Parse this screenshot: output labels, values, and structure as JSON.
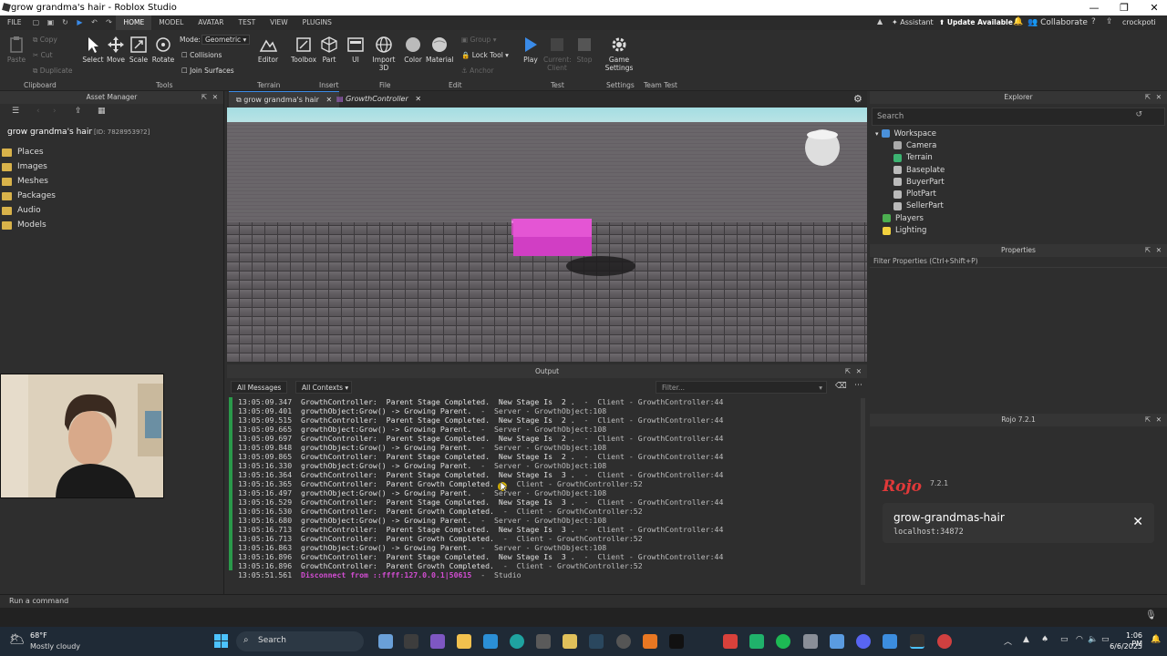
{
  "window": {
    "title": "grow grandma's hair - Roblox Studio"
  },
  "menubar": {
    "file": "FILE",
    "tabs": [
      "HOME",
      "MODEL",
      "AVATAR",
      "TEST",
      "VIEW",
      "PLUGINS"
    ],
    "assistant": "Assistant",
    "update": "Update Available",
    "collaborate": "Collaborate",
    "user": "crockpoti"
  },
  "ribbon": {
    "clipboard": {
      "copy": "Copy",
      "cut": "Cut",
      "paste": "Paste",
      "duplicate": "Duplicate",
      "group": "Clipboard"
    },
    "tools": {
      "select": "Select",
      "move": "Move",
      "scale": "Scale",
      "rotate": "Rotate",
      "group": "Tools",
      "mode_label": "Mode:",
      "mode_value": "Geometric",
      "collisions": "Collisions",
      "join_surfaces": "Join Surfaces"
    },
    "terrain": {
      "editor": "Editor",
      "group": "Terrain"
    },
    "insert": {
      "toolbox": "Toolbox",
      "part": "Part",
      "ui": "UI",
      "group": "Insert"
    },
    "file": {
      "import3d": "Import 3D",
      "group": "File"
    },
    "edit": {
      "color": "Color",
      "material": "Material",
      "group_btn": "Group",
      "lock": "Lock Tool",
      "anchor": "Anchor",
      "group": "Edit"
    },
    "test": {
      "play": "Play",
      "current_client": "Current: Client",
      "stop": "Stop",
      "group": "Test"
    },
    "settings": {
      "game_settings": "Game Settings",
      "group": "Settings"
    },
    "team_test": {
      "group": "Team Test"
    }
  },
  "asset_manager": {
    "title": "Asset Manager",
    "place_name": "grow grandma's hair",
    "place_id": "[ID: 78289539?2]",
    "folders": [
      "Places",
      "Images",
      "Meshes",
      "Packages",
      "Audio",
      "Models"
    ]
  },
  "doc_tabs": [
    {
      "label": "grow grandma's hair"
    },
    {
      "label": "GrowthController"
    }
  ],
  "output": {
    "title": "Output",
    "filter_messages": "All Messages",
    "filter_contexts": "All Contexts",
    "filter_placeholder": "Filter...",
    "lines": [
      {
        "ts": "13:05:09.347",
        "msg": "GrowthController:  Parent Stage Completed.  New Stage Is  2 .",
        "src": "  -  Client - GrowthController:44"
      },
      {
        "ts": "13:05:09.401",
        "msg": "growthObject:Grow() -> Growing Parent.",
        "src": "  -  Server - GrowthObject:108"
      },
      {
        "ts": "13:05:09.515",
        "msg": "GrowthController:  Parent Stage Completed.  New Stage Is  2 .",
        "src": "  -  Client - GrowthController:44"
      },
      {
        "ts": "13:05:09.665",
        "msg": "growthObject:Grow() -> Growing Parent.",
        "src": "  -  Server - GrowthObject:108"
      },
      {
        "ts": "13:05:09.697",
        "msg": "GrowthController:  Parent Stage Completed.  New Stage Is  2 .",
        "src": "  -  Client - GrowthController:44"
      },
      {
        "ts": "13:05:09.848",
        "msg": "growthObject:Grow() -> Growing Parent.",
        "src": "  -  Server - GrowthObject:108"
      },
      {
        "ts": "13:05:09.865",
        "msg": "GrowthController:  Parent Stage Completed.  New Stage Is  2 .",
        "src": "  -  Client - GrowthController:44"
      },
      {
        "ts": "13:05:16.330",
        "msg": "growthObject:Grow() -> Growing Parent.",
        "src": "  -  Server - GrowthObject:108"
      },
      {
        "ts": "13:05:16.364",
        "msg": "GrowthController:  Parent Stage Completed.  New Stage Is  3 .",
        "src": "  -  Client - GrowthController:44"
      },
      {
        "ts": "13:05:16.365",
        "msg": "GrowthController:  Parent Growth Completed.",
        "src": "  -  Client - GrowthController:52"
      },
      {
        "ts": "13:05:16.497",
        "msg": "growthObject:Grow() -> Growing Parent.",
        "src": "  -  Server - GrowthObject:108"
      },
      {
        "ts": "13:05:16.529",
        "msg": "GrowthController:  Parent Stage Completed.  New Stage Is  3 .",
        "src": "  -  Client - GrowthController:44"
      },
      {
        "ts": "13:05:16.530",
        "msg": "GrowthController:  Parent Growth Completed.",
        "src": "  -  Client - GrowthController:52"
      },
      {
        "ts": "13:05:16.680",
        "msg": "growthObject:Grow() -> Growing Parent.",
        "src": "  -  Server - GrowthObject:108"
      },
      {
        "ts": "13:05:16.713",
        "msg": "GrowthController:  Parent Stage Completed.  New Stage Is  3 .",
        "src": "  -  Client - GrowthController:44"
      },
      {
        "ts": "13:05:16.713",
        "msg": "GrowthController:  Parent Growth Completed.",
        "src": "  -  Client - GrowthController:52"
      },
      {
        "ts": "13:05:16.863",
        "msg": "growthObject:Grow() -> Growing Parent.",
        "src": "  -  Server - GrowthObject:108"
      },
      {
        "ts": "13:05:16.896",
        "msg": "GrowthController:  Parent Stage Completed.  New Stage Is  3 .",
        "src": "  -  Client - GrowthController:44"
      },
      {
        "ts": "13:05:16.896",
        "msg": "GrowthController:  Parent Growth Completed.",
        "src": "  -  Client - GrowthController:52"
      },
      {
        "ts": "13:05:51.561",
        "msg": "Disconnect from ::ffff:127.0.0.1|50615",
        "src": "  -  Studio",
        "disconnect": true
      }
    ]
  },
  "explorer": {
    "title": "Explorer",
    "search_placeholder": "Search",
    "items": [
      {
        "label": "Workspace",
        "level": 0
      },
      {
        "label": "Camera",
        "level": 1
      },
      {
        "label": "Terrain",
        "level": 1
      },
      {
        "label": "Baseplate",
        "level": 1
      },
      {
        "label": "BuyerPart",
        "level": 1
      },
      {
        "label": "PlotPart",
        "level": 1
      },
      {
        "label": "SellerPart",
        "level": 1
      },
      {
        "label": "Players",
        "level": 0
      },
      {
        "label": "Lighting",
        "level": 0
      }
    ]
  },
  "properties": {
    "title": "Properties",
    "filter_placeholder": "Filter Properties (Ctrl+Shift+P)"
  },
  "rojo": {
    "title": "Rojo 7.2.1",
    "version": "7.2.1",
    "project": "grow-grandmas-hair",
    "address": "localhost:34872"
  },
  "command_bar": {
    "placeholder": "Run a command"
  },
  "taskbar": {
    "weather_temp": "68°F",
    "weather_desc": "Mostly cloudy",
    "search": "Search",
    "time": "1:06 PM",
    "date": "6/6/2025"
  },
  "colors": {
    "part": "#e14fd0",
    "log_green": "#2a9a4a",
    "disconnect": "#d24dd2",
    "accent": "#3a8be8"
  }
}
